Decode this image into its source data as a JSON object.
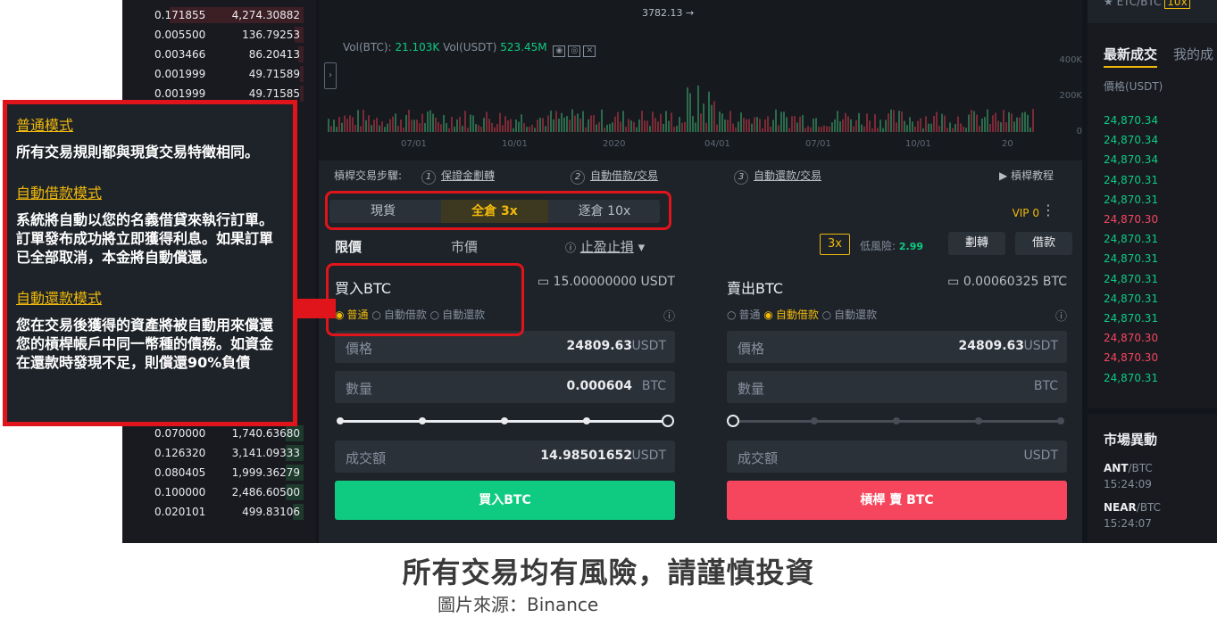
{
  "orderbook": {
    "top_rows": [
      {
        "price": "0.171855",
        "qty": "4,274.30882",
        "fill": 0.75,
        "side": "red"
      },
      {
        "price": "0.005500",
        "qty": "136.79253",
        "fill": 0.05,
        "side": "red"
      },
      {
        "price": "0.003466",
        "qty": "86.20413",
        "fill": 0.03,
        "side": "red"
      },
      {
        "price": "0.001999",
        "qty": "49.71589",
        "fill": 0.02,
        "side": "red"
      },
      {
        "price": "0.001999",
        "qty": "49.71585",
        "fill": 0.02,
        "side": "red"
      }
    ],
    "bottom_rows": [
      {
        "price": "0.070000",
        "qty": "1,740.63680",
        "fill": 0.1,
        "side": "green"
      },
      {
        "price": "0.126320",
        "qty": "3,141.09333",
        "fill": 0.1,
        "side": "green"
      },
      {
        "price": "0.080405",
        "qty": "1,999.36279",
        "fill": 0.1,
        "side": "green"
      },
      {
        "price": "0.100000",
        "qty": "2,486.60500",
        "fill": 0.1,
        "side": "green"
      },
      {
        "price": "0.020101",
        "qty": "499.83106",
        "fill": 0.06,
        "side": "green"
      }
    ]
  },
  "chart": {
    "price_marker": "3782.13",
    "volume_label": "Vol(BTC):",
    "volume_btc": "21.103K",
    "volume_usdt_label": "Vol(USDT)",
    "volume_usdt": "523.45M",
    "y_ticks": [
      "400K",
      "200K",
      "0"
    ],
    "x_ticks": [
      "07/01",
      "10/01",
      "2020",
      "04/01",
      "07/01",
      "10/01",
      "20"
    ]
  },
  "steps": {
    "label": "槓桿交易步驟:",
    "items": [
      {
        "num": "1",
        "text": "保證金劃轉"
      },
      {
        "num": "2",
        "text": "自動借款/交易"
      },
      {
        "num": "3",
        "text": "自動還款/交易"
      }
    ],
    "tutorial": "槓桿教程"
  },
  "trade": {
    "modes": [
      "現貨",
      "全倉 3x",
      "逐倉 10x"
    ],
    "active_mode": 1,
    "vip": "VIP 0",
    "order_tabs": [
      "限價",
      "市價",
      "止盈止損"
    ],
    "leverage": "3x",
    "risk_label": "低風險:",
    "risk_value": "2.99",
    "transfer_btn": "劃轉",
    "borrow_btn": "借款",
    "buy": {
      "title": "買入BTC",
      "available": "15.00000000 USDT",
      "radios": [
        "普通",
        "自動借款",
        "自動還款"
      ],
      "selected_radio": 0,
      "price_label": "價格",
      "price_value": "24809.63",
      "price_unit": "USDT",
      "amount_label": "數量",
      "amount_value": "0.000604",
      "amount_unit": "BTC",
      "total_label": "成交額",
      "total_value": "14.98501652",
      "total_unit": "USDT",
      "slider_percent": 100,
      "button": "買入BTC",
      "button_color": "#0ecb81"
    },
    "sell": {
      "title": "賣出BTC",
      "available": "0.00060325 BTC",
      "radios": [
        "普通",
        "自動借款",
        "自動還款"
      ],
      "selected_radio": 1,
      "price_label": "價格",
      "price_value": "24809.63",
      "price_unit": "USDT",
      "amount_label": "數量",
      "amount_value": "",
      "amount_unit": "BTC",
      "total_label": "成交額",
      "total_value": "",
      "total_unit": "USDT",
      "slider_percent": 0,
      "button": "槓桿 賣 BTC",
      "button_color": "#f6465d"
    }
  },
  "trades": {
    "pair": "ETC/BTC",
    "pair_badge": "10x",
    "tab_latest": "最新成交",
    "tab_mine": "我的成",
    "header": "價格(USDT)",
    "rows": [
      {
        "price": "24,870.34",
        "color": "#0ecb81"
      },
      {
        "price": "24,870.34",
        "color": "#0ecb81"
      },
      {
        "price": "24,870.34",
        "color": "#0ecb81"
      },
      {
        "price": "24,870.31",
        "color": "#0ecb81"
      },
      {
        "price": "24,870.31",
        "color": "#0ecb81"
      },
      {
        "price": "24,870.30",
        "color": "#f6465d"
      },
      {
        "price": "24,870.31",
        "color": "#0ecb81"
      },
      {
        "price": "24,870.31",
        "color": "#0ecb81"
      },
      {
        "price": "24,870.31",
        "color": "#0ecb81"
      },
      {
        "price": "24,870.31",
        "color": "#0ecb81"
      },
      {
        "price": "24,870.31",
        "color": "#0ecb81"
      },
      {
        "price": "24,870.30",
        "color": "#f6465d"
      },
      {
        "price": "24,870.30",
        "color": "#f6465d"
      },
      {
        "price": "24,870.31",
        "color": "#0ecb81"
      }
    ]
  },
  "market": {
    "title": "市場異動",
    "items": [
      {
        "pair": "ANT",
        "quote": "/BTC",
        "time": "15:24:09"
      },
      {
        "pair": "NEAR",
        "quote": "/BTC",
        "time": "15:24:07"
      }
    ]
  },
  "note": {
    "h1": "普通模式",
    "t1": "所有交易規則都與現貨交易特徵相同。",
    "h2": "自動借款模式",
    "t2": "系統將自動以您的名義借貸來執行訂單。訂單發布成功將立即獲得利息。如果訂單已全部取消，本金將自動償還。",
    "h3": "自動還款模式",
    "t3": "您在交易後獲得的資產將被自動用來償還您的槓桿帳戶中同一幣種的債務。如資金在還款時發現不足，則償還90%負債"
  },
  "footer": {
    "title": "所有交易均有風險，請謹慎投資",
    "source": "圖片來源：Binance"
  }
}
